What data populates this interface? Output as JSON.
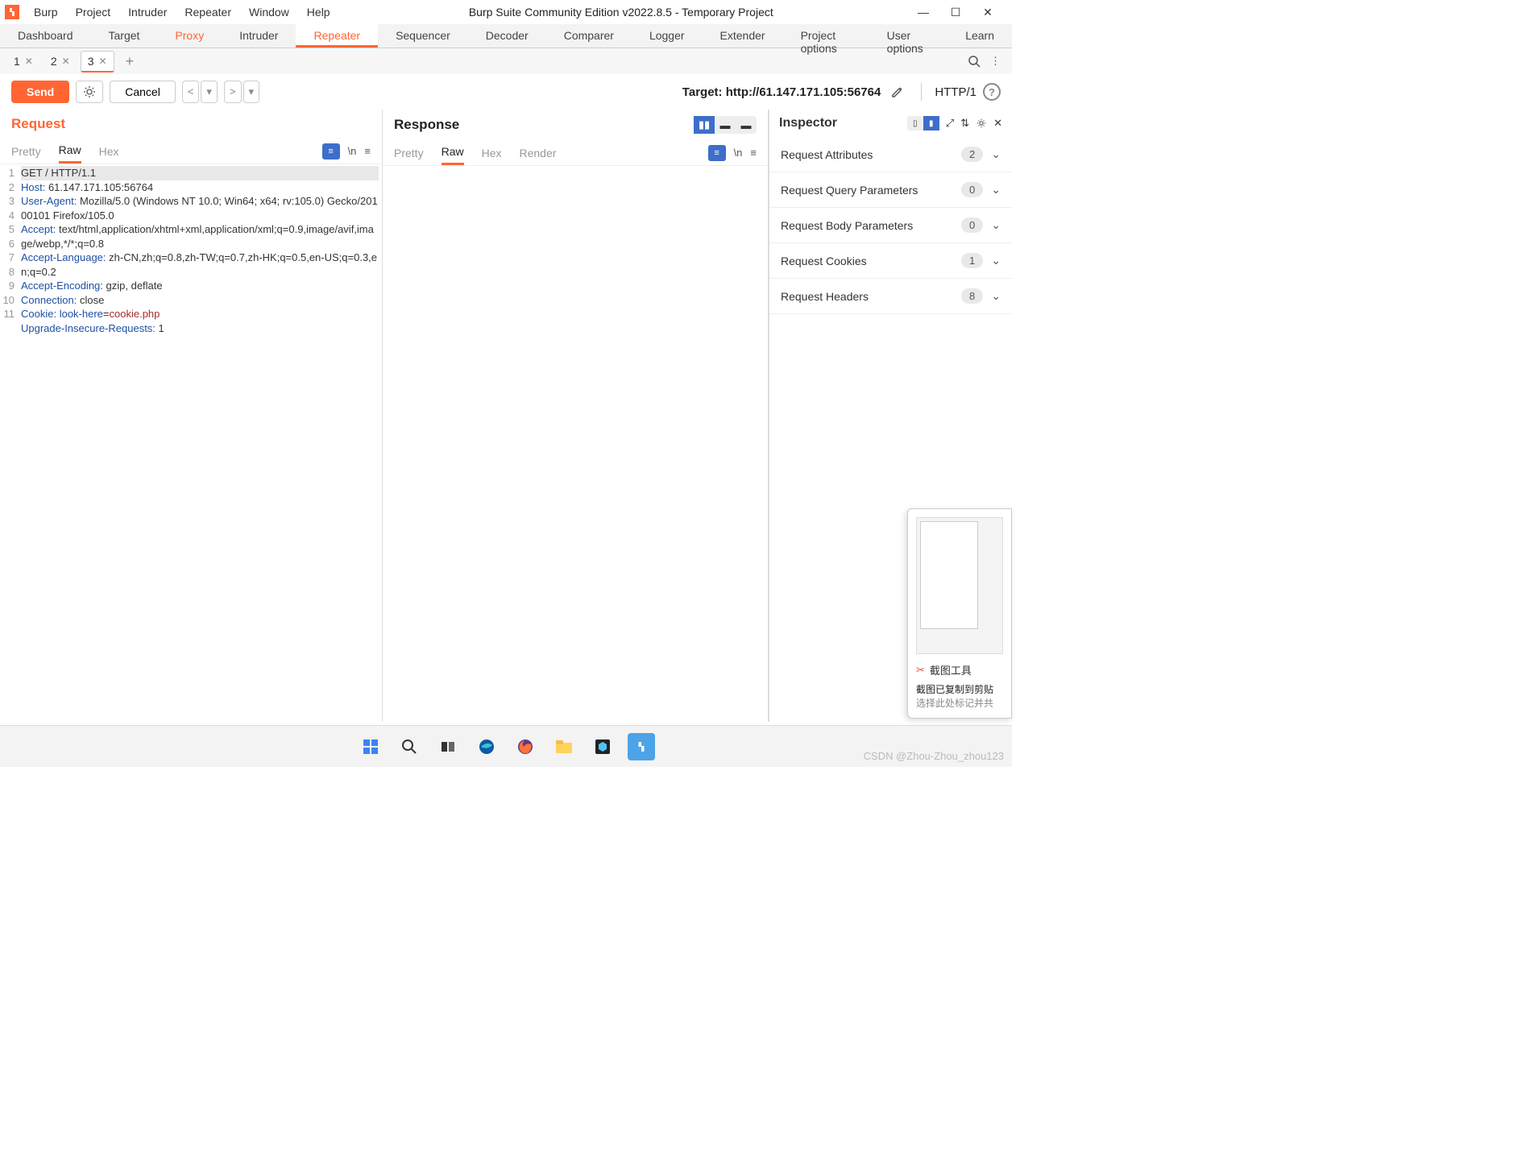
{
  "titlebar": {
    "menus": [
      "Burp",
      "Project",
      "Intruder",
      "Repeater",
      "Window",
      "Help"
    ],
    "title": "Burp Suite Community Edition v2022.8.5 - Temporary Project"
  },
  "main_tabs": [
    "Dashboard",
    "Target",
    "Proxy",
    "Intruder",
    "Repeater",
    "Sequencer",
    "Decoder",
    "Comparer",
    "Logger",
    "Extender",
    "Project options",
    "User options",
    "Learn"
  ],
  "main_tab_active": "Repeater",
  "main_tab_orange": "Proxy",
  "subtabs": {
    "items": [
      "1",
      "2",
      "3"
    ],
    "active": "3"
  },
  "action_bar": {
    "send": "Send",
    "cancel": "Cancel",
    "target_label": "Target: http://61.147.171.105:56764",
    "http_version": "HTTP/1"
  },
  "request": {
    "title": "Request",
    "tabs": [
      "Pretty",
      "Raw",
      "Hex"
    ],
    "active_tab": "Raw",
    "lines": [
      {
        "n": 1,
        "text": "GET / HTTP/1.1",
        "highlight": true
      },
      {
        "n": 2,
        "parts": [
          {
            "t": "Host:",
            "cls": "kw"
          },
          {
            "t": " 61.147.171.105:56764"
          }
        ]
      },
      {
        "n": 3,
        "parts": [
          {
            "t": "User-Agent:",
            "cls": "kw"
          },
          {
            "t": " Mozilla/5.0 (Windows NT 10.0; Win64; x64; rv:105.0) Gecko/20100101 Firefox/105.0"
          }
        ]
      },
      {
        "n": 4,
        "parts": [
          {
            "t": "Accept:",
            "cls": "kw"
          },
          {
            "t": " text/html,application/xhtml+xml,application/xml;q=0.9,image/avif,image/webp,*/*;q=0.8"
          }
        ]
      },
      {
        "n": 5,
        "parts": [
          {
            "t": "Accept-Language:",
            "cls": "kw"
          },
          {
            "t": " zh-CN,zh;q=0.8,zh-TW;q=0.7,zh-HK;q=0.5,en-US;q=0.3,en;q=0.2"
          }
        ]
      },
      {
        "n": 6,
        "parts": [
          {
            "t": "Accept-Encoding:",
            "cls": "kw"
          },
          {
            "t": " gzip, deflate"
          }
        ]
      },
      {
        "n": 7,
        "parts": [
          {
            "t": "Connection:",
            "cls": "kw"
          },
          {
            "t": " close"
          }
        ]
      },
      {
        "n": 8,
        "parts": [
          {
            "t": "Cookie:",
            "cls": "kw"
          },
          {
            "t": " "
          },
          {
            "t": "look-here",
            "cls": "num"
          },
          {
            "t": "="
          },
          {
            "t": "cookie.php",
            "cls": "val"
          }
        ]
      },
      {
        "n": 9,
        "parts": [
          {
            "t": "Upgrade-Insecure-Requests:",
            "cls": "kw"
          },
          {
            "t": " 1"
          }
        ]
      },
      {
        "n": 10,
        "text": ""
      },
      {
        "n": 11,
        "text": ""
      }
    ]
  },
  "response": {
    "title": "Response",
    "tabs": [
      "Pretty",
      "Raw",
      "Hex",
      "Render"
    ],
    "active_tab": "Raw"
  },
  "inspector": {
    "title": "Inspector",
    "rows": [
      {
        "label": "Request Attributes",
        "count": "2"
      },
      {
        "label": "Request Query Parameters",
        "count": "0"
      },
      {
        "label": "Request Body Parameters",
        "count": "0"
      },
      {
        "label": "Request Cookies",
        "count": "1"
      },
      {
        "label": "Request Headers",
        "count": "8"
      }
    ]
  },
  "snip_toast": {
    "title": "截图工具",
    "line1": "截图已复制到剪贴",
    "line2": "选择此处标记并共"
  },
  "watermark": "CSDN @Zhou-Zhou_zhou123"
}
